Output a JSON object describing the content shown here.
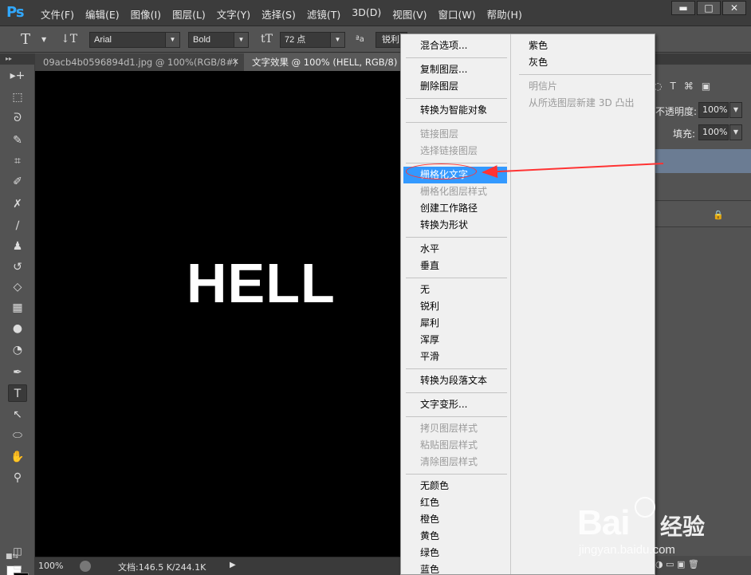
{
  "app": {
    "logo": "Ps",
    "menus": [
      "文件(F)",
      "编辑(E)",
      "图像(I)",
      "图层(L)",
      "文字(Y)",
      "选择(S)",
      "滤镜(T)",
      "3D(D)",
      "视图(V)",
      "窗口(W)",
      "帮助(H)"
    ],
    "window_buttons": {
      "minimize": "▬",
      "maximize": "□",
      "close": "✕"
    }
  },
  "options_bar": {
    "tool_glyph": "T",
    "orient_glyph": "↓T",
    "font_family": "Arial",
    "font_style": "Bold",
    "size_glyph": "tT",
    "font_size": "72 点",
    "aa_glyph": "ªa",
    "antialias": "锐利"
  },
  "tabs": [
    {
      "label": "09acb4b0596894d1.jpg @ 100%(RGB/8#)",
      "close": "✕"
    },
    {
      "label": "文字效果 @ 100% (HELL, RGB/8) *",
      "close": "✕"
    }
  ],
  "toolbox": {
    "collapse": "▸▸",
    "tools": [
      {
        "name": "move-tool",
        "glyph": "▸+"
      },
      {
        "name": "marquee-tool",
        "glyph": "⬚"
      },
      {
        "name": "lasso-tool",
        "glyph": "ᘐ"
      },
      {
        "name": "quick-select-tool",
        "glyph": "✎"
      },
      {
        "name": "crop-tool",
        "glyph": "⌗"
      },
      {
        "name": "eyedropper-tool",
        "glyph": "✐"
      },
      {
        "name": "healing-tool",
        "glyph": "✗"
      },
      {
        "name": "brush-tool",
        "glyph": "∕"
      },
      {
        "name": "stamp-tool",
        "glyph": "♟"
      },
      {
        "name": "history-brush-tool",
        "glyph": "↺"
      },
      {
        "name": "eraser-tool",
        "glyph": "◇"
      },
      {
        "name": "gradient-tool",
        "glyph": "▦"
      },
      {
        "name": "blur-tool",
        "glyph": "●"
      },
      {
        "name": "dodge-tool",
        "glyph": "◔"
      },
      {
        "name": "pen-tool",
        "glyph": "✒"
      },
      {
        "name": "type-tool",
        "glyph": "T"
      },
      {
        "name": "path-select-tool",
        "glyph": "↖"
      },
      {
        "name": "ellipse-tool",
        "glyph": "⬭"
      },
      {
        "name": "hand-tool",
        "glyph": "✋"
      },
      {
        "name": "zoom-tool",
        "glyph": "⚲"
      }
    ],
    "swatch_mini": "■⇆",
    "quickmask": "◫",
    "screenmode": "▭"
  },
  "canvas": {
    "text": "HELL",
    "bg_color": "#000000",
    "text_color": "#ffffff"
  },
  "status": {
    "zoom": "100%",
    "doc": "文档:146.5 K/244.1K",
    "arrow": "▶"
  },
  "right_panel": {
    "opacity_label": "不透明度:",
    "opacity_value": "100%",
    "fill_label": "填充:",
    "fill_value": "100%",
    "icons": [
      "◌",
      "T",
      "⌘",
      "▣"
    ],
    "lock": "🔒",
    "bottom_icons": "◑ ▭ ▣ 🗑"
  },
  "context_menu": {
    "left": [
      {
        "label": "混合选项...",
        "disabled": false
      },
      {
        "sep": true
      },
      {
        "label": "复制图层...",
        "disabled": false
      },
      {
        "label": "删除图层",
        "disabled": false
      },
      {
        "sep": true
      },
      {
        "label": "转换为智能对象",
        "disabled": false
      },
      {
        "sep": true
      },
      {
        "label": "链接图层",
        "disabled": true
      },
      {
        "label": "选择链接图层",
        "disabled": true
      },
      {
        "sep": true
      },
      {
        "label": "栅格化文字",
        "disabled": false,
        "highlighted": true
      },
      {
        "label": "栅格化图层样式",
        "disabled": true
      },
      {
        "label": "创建工作路径",
        "disabled": false
      },
      {
        "label": "转换为形状",
        "disabled": false
      },
      {
        "sep": true
      },
      {
        "label": "水平",
        "disabled": false
      },
      {
        "label": "垂直",
        "disabled": false
      },
      {
        "sep": true
      },
      {
        "label": "无",
        "disabled": false
      },
      {
        "label": "锐利",
        "disabled": false
      },
      {
        "label": "犀利",
        "disabled": false
      },
      {
        "label": "浑厚",
        "disabled": false
      },
      {
        "label": "平滑",
        "disabled": false
      },
      {
        "sep": true
      },
      {
        "label": "转换为段落文本",
        "disabled": false
      },
      {
        "sep": true
      },
      {
        "label": "文字变形...",
        "disabled": false
      },
      {
        "sep": true
      },
      {
        "label": "拷贝图层样式",
        "disabled": true
      },
      {
        "label": "粘贴图层样式",
        "disabled": true
      },
      {
        "label": "清除图层样式",
        "disabled": true
      },
      {
        "sep": true
      },
      {
        "label": "无颜色",
        "disabled": false
      },
      {
        "label": "红色",
        "disabled": false
      },
      {
        "label": "橙色",
        "disabled": false
      },
      {
        "label": "黄色",
        "disabled": false
      },
      {
        "label": "绿色",
        "disabled": false
      },
      {
        "label": "蓝色",
        "disabled": false
      }
    ],
    "right": [
      {
        "label": "紫色",
        "disabled": false
      },
      {
        "label": "灰色",
        "disabled": false
      },
      {
        "sep": true
      },
      {
        "label": "明信片",
        "disabled": true
      },
      {
        "label": "从所选图层新建 3D 凸出",
        "disabled": true
      }
    ]
  },
  "watermark": {
    "logo": "Bai",
    "cn": "经验",
    "url": "jingyan.baidu.com"
  },
  "colors": {
    "highlight": "#3399ff",
    "annotation": "#ff3333",
    "ps_blue": "#31a8ff"
  }
}
